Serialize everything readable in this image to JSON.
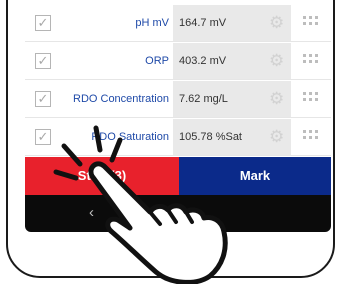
{
  "rows": [
    {
      "label": "pH mV",
      "value": "164.7 mV",
      "checked": true
    },
    {
      "label": "ORP",
      "value": "403.2 mV",
      "checked": true
    },
    {
      "label": "RDO Concentration",
      "value": "7.62 mg/L",
      "checked": true
    },
    {
      "label": "RDO Saturation",
      "value": "105.78 %Sat",
      "checked": true
    }
  ],
  "actions": {
    "stop_label": "Stop (3)",
    "mark_label": "Mark"
  },
  "nav": {
    "back_glyph": "‹"
  },
  "colors": {
    "stop": "#e8212c",
    "mark": "#0b2a8a",
    "label": "#1f4aa8"
  },
  "icons": [
    "checkbox-icon",
    "gear-icon",
    "drag-handle-icon",
    "back-icon",
    "home-icon",
    "tap-hand-icon"
  ]
}
